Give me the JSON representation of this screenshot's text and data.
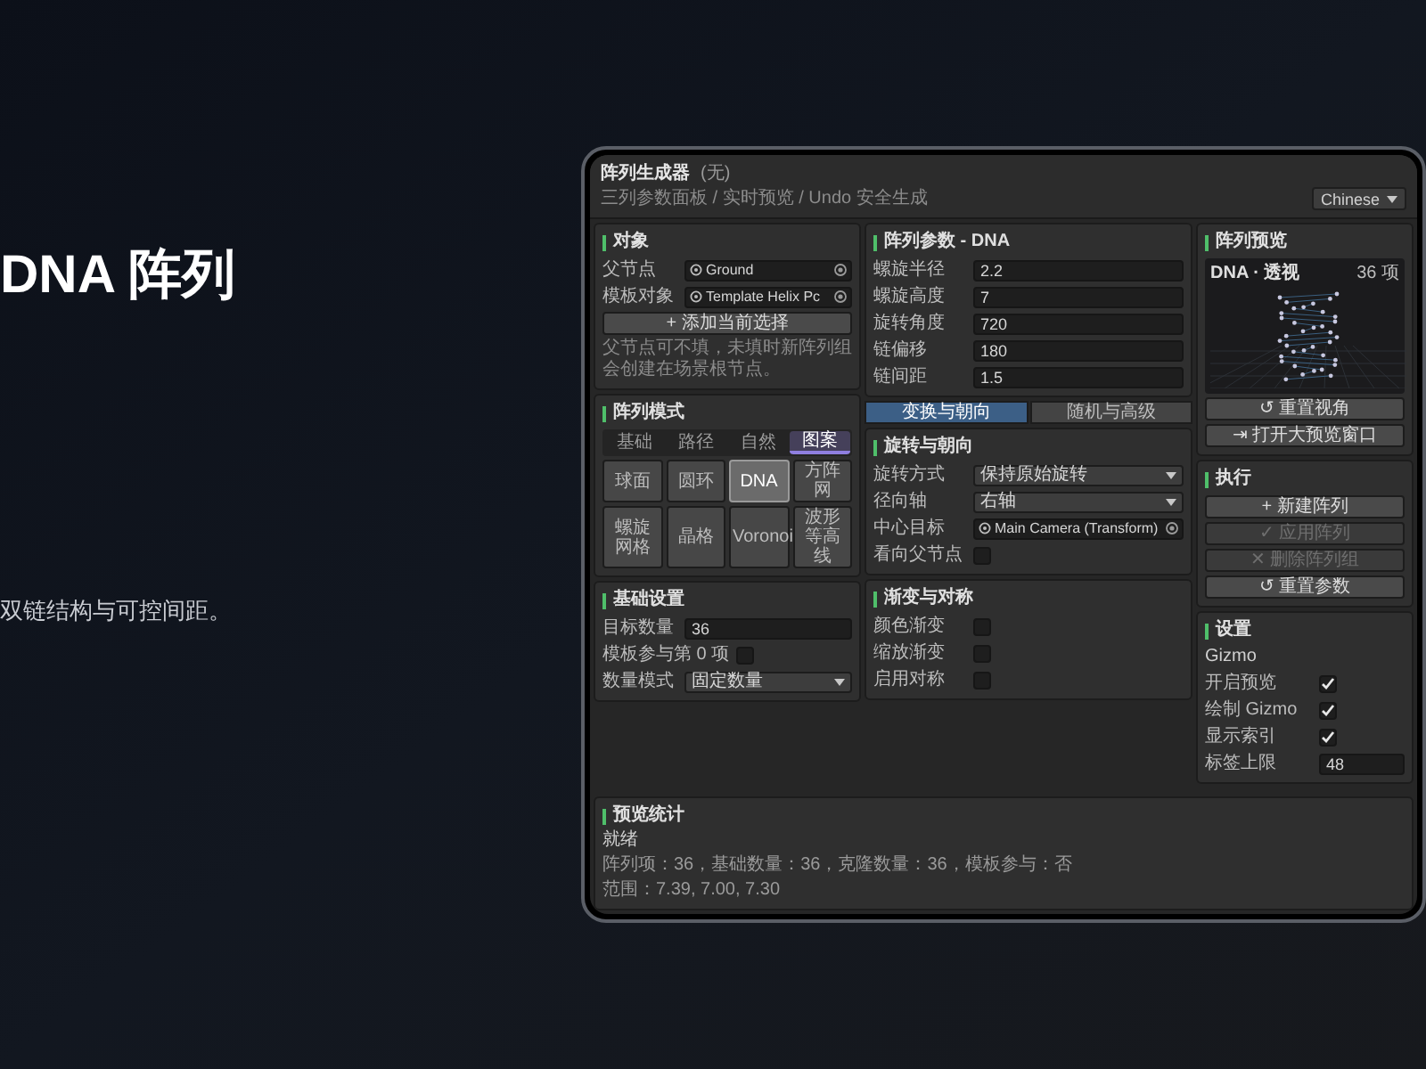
{
  "slide": {
    "title": "DNA 阵列",
    "subtitle": "双链结构与可控间距。"
  },
  "app": {
    "title": "阵列生成器",
    "title_note": "(无)",
    "subtitle": "三列参数面板 / 实时预览 / Undo 安全生成",
    "language": "Chinese"
  },
  "object_section": {
    "title": "对象",
    "rows": [
      {
        "kind": "object",
        "label": "父节点",
        "value": "Ground"
      },
      {
        "kind": "object",
        "label": "模板对象",
        "value": "Template Helix Pc"
      }
    ],
    "add_button": "+ 添加当前选择",
    "note": "父节点可不填，未填时新阵列组会创建在场景根节点。"
  },
  "mode_section": {
    "title": "阵列模式",
    "tabs": [
      {
        "label": "基础",
        "selected": false
      },
      {
        "label": "路径",
        "selected": false
      },
      {
        "label": "自然",
        "selected": false
      },
      {
        "label": "图案",
        "selected": true
      }
    ],
    "modes": [
      {
        "label": "球面",
        "selected": false
      },
      {
        "label": "圆环",
        "selected": false
      },
      {
        "label": "DNA",
        "selected": true
      },
      {
        "label": "方阵网",
        "selected": false
      },
      {
        "label": "螺旋网格",
        "selected": false
      },
      {
        "label": "晶格",
        "selected": false
      },
      {
        "label": "Voronoi",
        "selected": false
      },
      {
        "label": "波形等高线",
        "selected": false
      }
    ]
  },
  "basic_section": {
    "title": "基础设置",
    "rows": [
      {
        "kind": "number",
        "label": "目标数量",
        "value": "36"
      },
      {
        "kind": "checkbox",
        "label": "模板参与第 0 项",
        "checked": false
      },
      {
        "kind": "dropdown",
        "label": "数量模式",
        "value": "固定数量"
      }
    ]
  },
  "params_section": {
    "title": "阵列参数 - DNA",
    "rows": [
      {
        "kind": "number",
        "label": "螺旋半径",
        "value": "2.2"
      },
      {
        "kind": "number",
        "label": "螺旋高度",
        "value": "7"
      },
      {
        "kind": "number",
        "label": "旋转角度",
        "value": "720"
      },
      {
        "kind": "number",
        "label": "链偏移",
        "value": "180"
      },
      {
        "kind": "number",
        "label": "链间距",
        "value": "1.5"
      }
    ]
  },
  "sub_tabs": [
    {
      "label": "变换与朝向",
      "selected": true
    },
    {
      "label": "随机与高级",
      "selected": false
    }
  ],
  "rotation_section": {
    "title": "旋转与朝向",
    "rows": [
      {
        "kind": "dropdown",
        "label": "旋转方式",
        "value": "保持原始旋转"
      },
      {
        "kind": "dropdown",
        "label": "径向轴",
        "value": "右轴"
      },
      {
        "kind": "object",
        "label": "中心目标",
        "value": "Main Camera (Transform)"
      },
      {
        "kind": "checkbox",
        "label": "看向父节点",
        "checked": false
      }
    ]
  },
  "gradient_section": {
    "title": "渐变与对称",
    "rows": [
      {
        "kind": "checkbox",
        "label": "颜色渐变",
        "checked": false
      },
      {
        "kind": "checkbox",
        "label": "缩放渐变",
        "checked": false
      },
      {
        "kind": "checkbox",
        "label": "启用对称",
        "checked": false
      }
    ]
  },
  "preview": {
    "title": "阵列预览",
    "view_label": "DNA · 透视",
    "count": "36 项",
    "buttons": [
      "↺ 重置视角",
      "⇥ 打开大预览窗口"
    ]
  },
  "execute": {
    "title": "执行",
    "buttons": [
      {
        "label": "+ 新建阵列",
        "disabled": false
      },
      {
        "label": "✓ 应用阵列",
        "disabled": true
      },
      {
        "label": "✕ 删除阵列组",
        "disabled": true
      },
      {
        "label": "↺ 重置参数",
        "disabled": false
      }
    ]
  },
  "settings": {
    "title": "设置",
    "group": "Gizmo",
    "rows": [
      {
        "kind": "checkbox",
        "label": "开启预览",
        "checked": true
      },
      {
        "kind": "checkbox",
        "label": "绘制 Gizmo",
        "checked": true
      },
      {
        "kind": "checkbox",
        "label": "显示索引",
        "checked": true
      },
      {
        "kind": "number",
        "label": "标签上限",
        "value": "48"
      }
    ]
  },
  "stats": {
    "title": "预览统计",
    "status": "就绪",
    "lines": [
      "阵列项：36，基础数量：36，克隆数量：36，模板参与：否",
      "范围：7.39, 7.00, 7.30"
    ]
  }
}
